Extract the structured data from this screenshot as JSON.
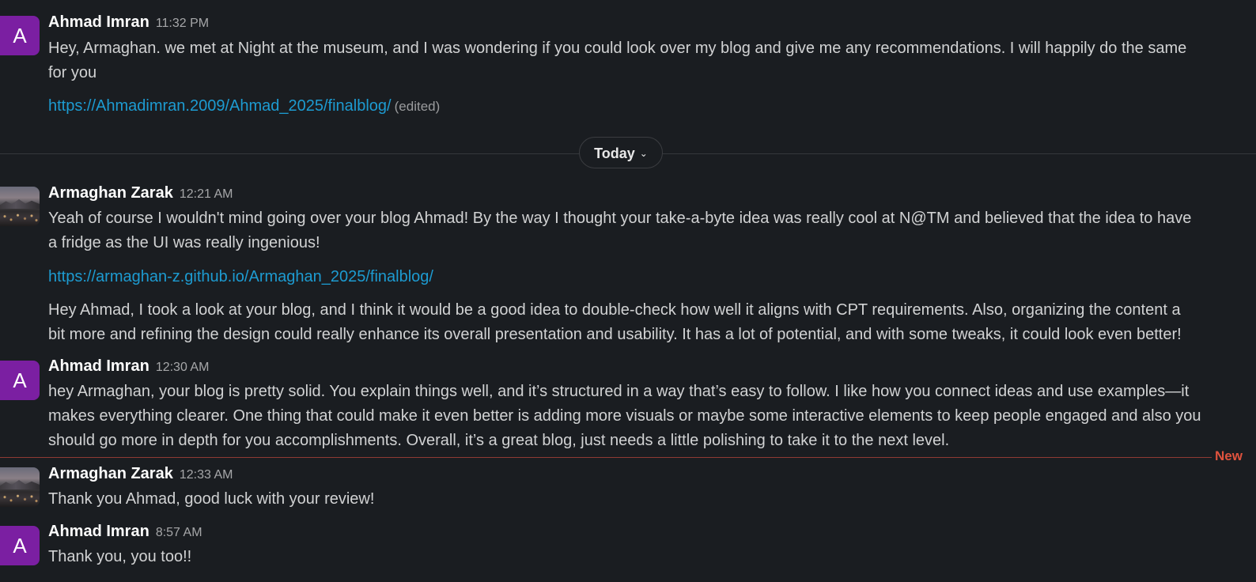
{
  "divider": {
    "label": "Today",
    "chevron": "chevron-down-icon"
  },
  "new_marker": {
    "label": "New"
  },
  "colors": {
    "background": "#1a1d21",
    "link": "#1d9bd1",
    "avatar_letter_bg": "#7b1fa2",
    "new_marker": "#e0533e"
  },
  "messages": [
    {
      "author": "Ahmad Imran",
      "avatar_letter": "A",
      "time": "11:32 PM",
      "text_lines": [
        "Hey, Armaghan. we met at Night at the museum, and I was wondering if you could look over my blog and give me any recommendations. I will happily do the same",
        "for you"
      ],
      "link": "https://Ahmadimran.2009/Ahmad_2025/finalblog/",
      "edited": "(edited)"
    },
    {
      "author": "Armaghan Zarak",
      "time": "12:21 AM",
      "text_lines": [
        "Yeah of course I wouldn't mind going over your blog Ahmad! By the way I thought your take-a-byte idea was really cool at N@TM and believed that the idea to have",
        "a fridge as the UI was really ingenious!"
      ],
      "link": "https://armaghan-z.github.io/Armaghan_2025/finalblog/",
      "followup_lines": [
        "Hey Ahmad, I took a look at your blog, and I think it would be a good idea to double-check how well it aligns with CPT requirements. Also, organizing the content a",
        "bit more and refining the design could really enhance its overall presentation and usability. It has a lot of potential, and with some tweaks, it could look even better!"
      ]
    },
    {
      "author": "Ahmad Imran",
      "avatar_letter": "A",
      "time": "12:30 AM",
      "text_lines": [
        "hey Armaghan, your blog is pretty solid. You explain things well, and it’s structured in a way that’s easy to follow. I like how you connect ideas and use examples—it",
        "makes everything clearer. One thing that could make it even better is adding more visuals or maybe some interactive elements to keep people engaged and also you",
        "should go more in depth for you accomplishments. Overall, it’s a great blog, just needs a little polishing to take it to the next level."
      ]
    },
    {
      "author": "Armaghan Zarak",
      "time": "12:33 AM",
      "text_lines": [
        "Thank you Ahmad, good luck with your review!"
      ]
    },
    {
      "author": "Ahmad Imran",
      "avatar_letter": "A",
      "time": "8:57 AM",
      "text_lines": [
        "Thank you, you too!!"
      ]
    }
  ]
}
